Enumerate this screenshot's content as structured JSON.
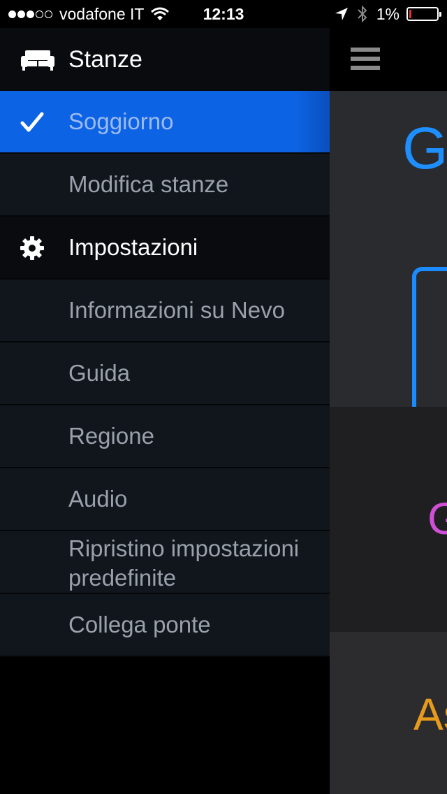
{
  "status_bar": {
    "carrier": "vodafone IT",
    "time": "12:13",
    "battery": "1%",
    "signal_bars_filled": 3,
    "signal_bars_total": 5
  },
  "drawer": {
    "header": {
      "title": "Stanze",
      "icon": "sofa-icon"
    },
    "items": [
      {
        "label": "Soggiorno",
        "state": "selected",
        "icon": "checkmark-icon"
      },
      {
        "label": "Modifica stanze"
      },
      {
        "label": "Impostazioni",
        "type": "section",
        "icon": "gear-icon"
      },
      {
        "label": "Informazioni su Nevo"
      },
      {
        "label": "Guida"
      },
      {
        "label": "Regione"
      },
      {
        "label": "Audio"
      },
      {
        "label": "Ripristino impostazioni predefinite"
      },
      {
        "label": "Collega ponte"
      }
    ]
  },
  "background_app": {
    "menu_icon": "hamburger-icon",
    "fragment_1": "G",
    "fragment_2": "G",
    "fragment_3": "As"
  },
  "colors": {
    "accent_blue": "#0c63e3",
    "drawer_item_bg": "#11151c",
    "section_bg": "#090b0e",
    "battery_low": "#e8312f"
  }
}
